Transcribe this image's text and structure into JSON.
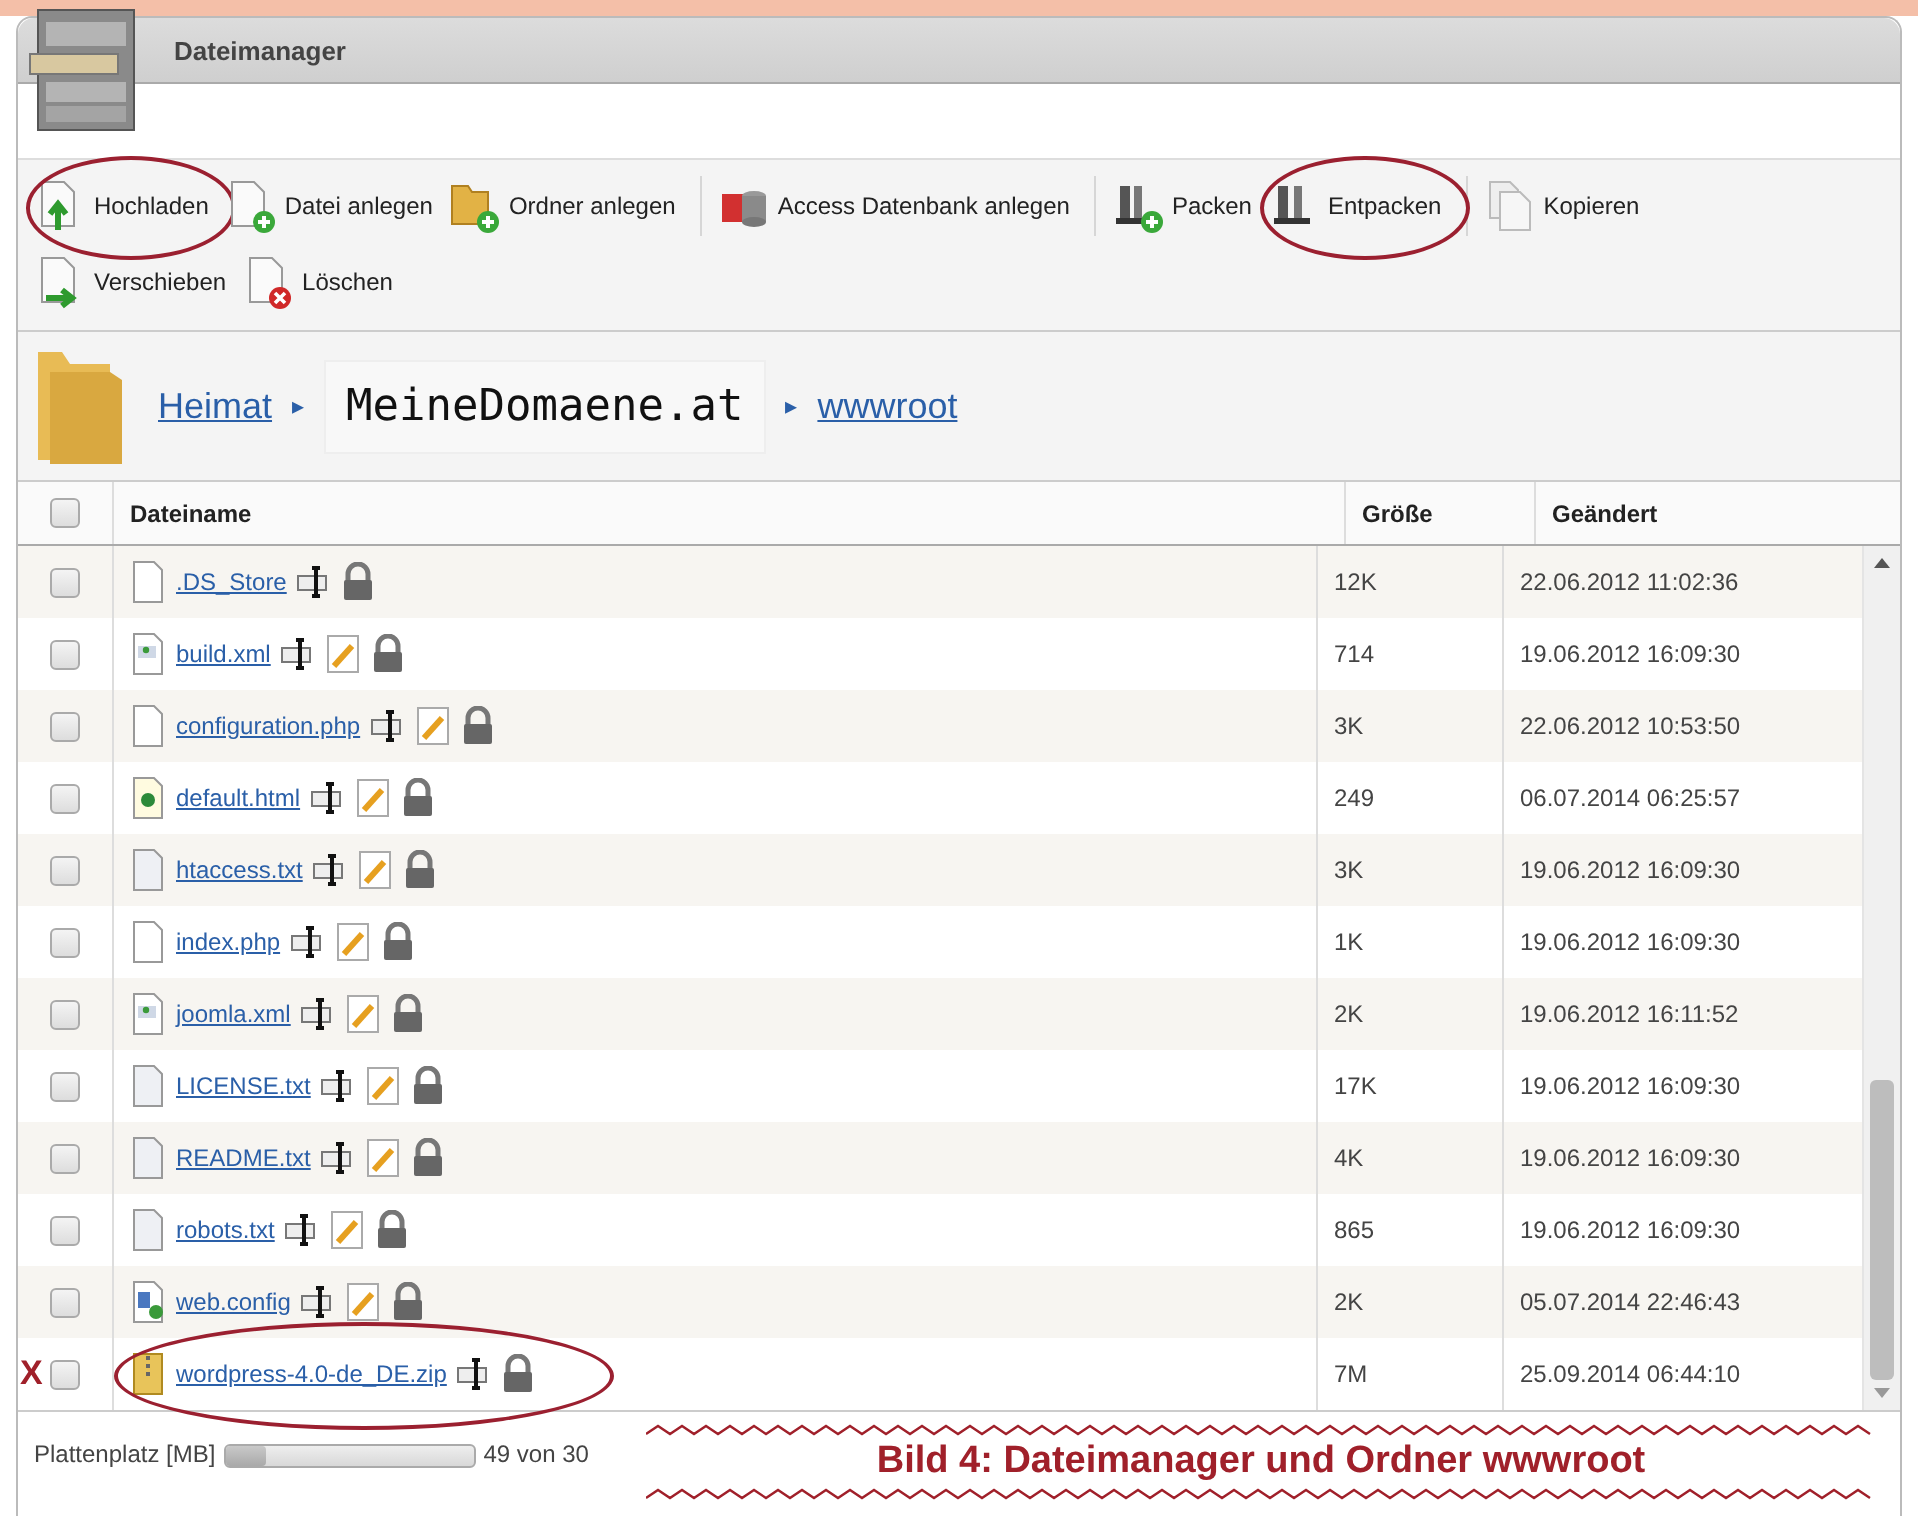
{
  "window": {
    "title": "Dateimanager"
  },
  "toolbar": {
    "rows": [
      [
        [
          {
            "label": "Hochladen",
            "kind": "upload",
            "circled": true
          },
          {
            "label": "Datei anlegen",
            "kind": "new-file",
            "circled": false
          },
          {
            "label": "Ordner anlegen",
            "kind": "new-folder",
            "circled": false
          }
        ],
        [
          {
            "label": "Access Datenbank anlegen",
            "kind": "database",
            "circled": false
          }
        ],
        [
          {
            "label": "Packen",
            "kind": "pack",
            "circled": false
          },
          {
            "label": "Entpacken",
            "kind": "unpack",
            "circled": true
          }
        ],
        [
          {
            "label": "Kopieren",
            "kind": "copy",
            "circled": false
          }
        ]
      ],
      [
        [
          {
            "label": "Verschieben",
            "kind": "move",
            "circled": false
          },
          {
            "label": "Löschen",
            "kind": "delete",
            "circled": false
          }
        ]
      ]
    ]
  },
  "breadcrumb": [
    {
      "label": "Heimat",
      "kind": "link"
    },
    {
      "label": "▸",
      "kind": "separator"
    },
    {
      "label": "MeineDomaene.at",
      "kind": "current"
    },
    {
      "label": "▸",
      "kind": "separator"
    },
    {
      "label": "wwwroot",
      "kind": "link"
    }
  ],
  "table": {
    "select_all": {
      "checked": false
    },
    "columns": [
      "Dateiname",
      "Größe",
      "Geändert"
    ],
    "rows": [
      {
        "name": ".DS_Store",
        "kind": "blank",
        "editable": false,
        "size": "12K",
        "modified": "22.06.2012 11:02:36",
        "checked": false
      },
      {
        "name": "build.xml",
        "kind": "xml",
        "editable": true,
        "size": "714",
        "modified": "19.06.2012 16:09:30",
        "checked": false
      },
      {
        "name": "configuration.php",
        "kind": "blank",
        "editable": true,
        "size": "3K",
        "modified": "22.06.2012 10:53:50",
        "checked": false
      },
      {
        "name": "default.html",
        "kind": "html",
        "editable": true,
        "size": "249",
        "modified": "06.07.2014 06:25:57",
        "checked": false
      },
      {
        "name": "htaccess.txt",
        "kind": "text",
        "editable": true,
        "size": "3K",
        "modified": "19.06.2012 16:09:30",
        "checked": false
      },
      {
        "name": "index.php",
        "kind": "blank",
        "editable": true,
        "size": "1K",
        "modified": "19.06.2012 16:09:30",
        "checked": false
      },
      {
        "name": "joomla.xml",
        "kind": "xml",
        "editable": true,
        "size": "2K",
        "modified": "19.06.2012 16:11:52",
        "checked": false
      },
      {
        "name": "LICENSE.txt",
        "kind": "text",
        "editable": true,
        "size": "17K",
        "modified": "19.06.2012 16:09:30",
        "checked": false
      },
      {
        "name": "README.txt",
        "kind": "text",
        "editable": true,
        "size": "4K",
        "modified": "19.06.2012 16:09:30",
        "checked": false
      },
      {
        "name": "robots.txt",
        "kind": "text",
        "editable": true,
        "size": "865",
        "modified": "19.06.2012 16:09:30",
        "checked": false
      },
      {
        "name": "web.config",
        "kind": "config",
        "editable": true,
        "size": "2K",
        "modified": "05.07.2014 22:46:43",
        "checked": false
      },
      {
        "name": "wordpress-4.0-de_DE.zip",
        "kind": "zip",
        "editable": false,
        "size": "7M",
        "modified": "25.09.2014 06:44:10",
        "checked": false,
        "annotation": "X",
        "circled": true
      }
    ]
  },
  "footer": {
    "label": "Plattenplatz [MB]",
    "level": 0.16,
    "reading": "49 von 30"
  },
  "caption": "Bild 4: Dateimanager und Ordner wwwroot"
}
